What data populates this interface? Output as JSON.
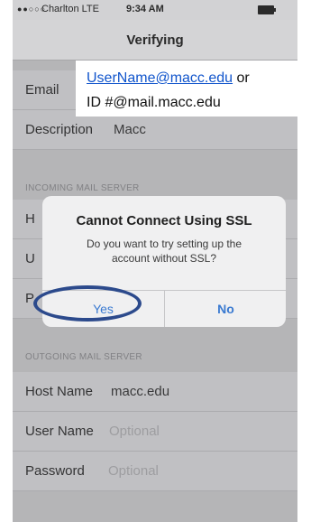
{
  "status_bar": {
    "carrier": "Charlton LTE",
    "time": "9:34 AM"
  },
  "nav": {
    "title": "Verifying"
  },
  "account": {
    "email_label": "Email",
    "description_label": "Description",
    "description_value": "Macc"
  },
  "incoming": {
    "header": "INCOMING MAIL SERVER"
  },
  "outgoing": {
    "header": "OUTGOING MAIL SERVER",
    "host_label": "Host Name",
    "host_value": "macc.edu",
    "user_label": "User Name",
    "user_placeholder": "Optional",
    "password_label": "Password",
    "password_placeholder": "Optional"
  },
  "alert": {
    "title": "Cannot Connect Using SSL",
    "message": "Do you want to try setting up the account without SSL?",
    "yes_label": "Yes",
    "no_label": "No"
  },
  "callout": {
    "link_text": "UserName@macc.edu",
    "after_link": " or",
    "line2": "ID #@mail.macc.edu"
  }
}
